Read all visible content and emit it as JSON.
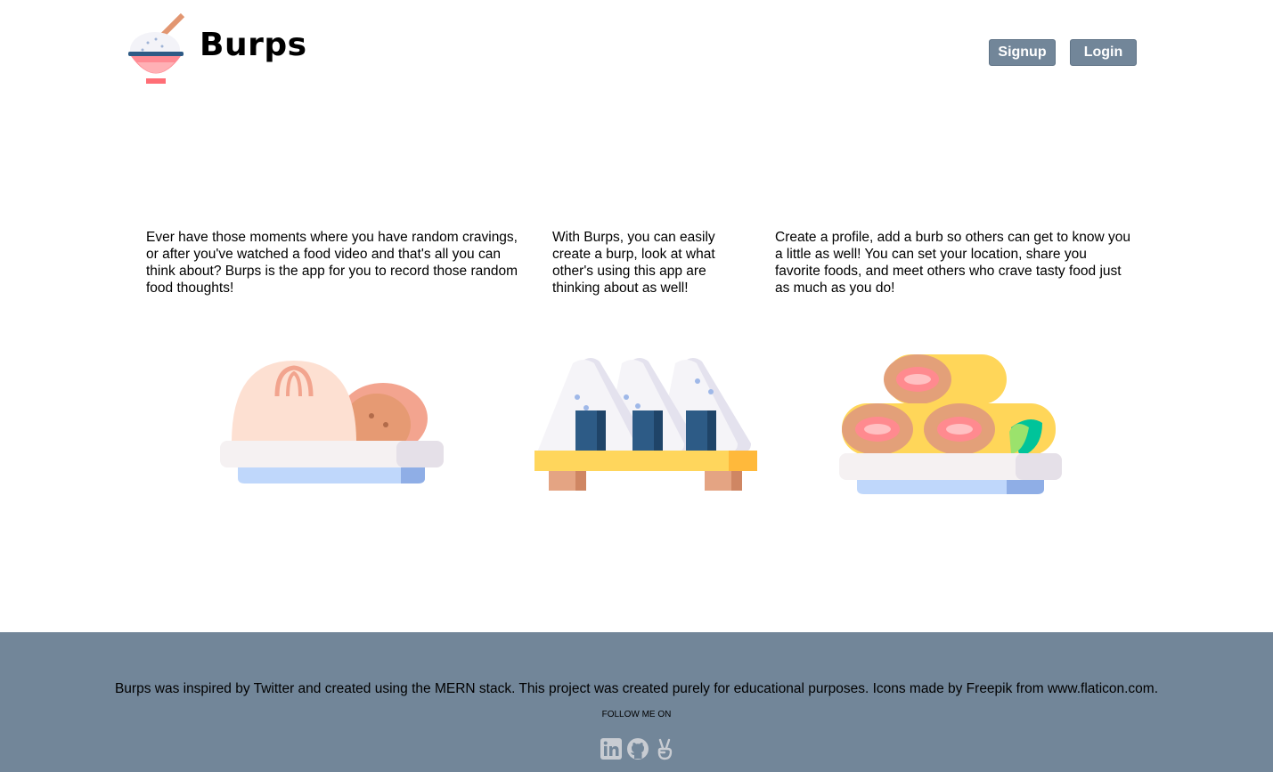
{
  "header": {
    "brand": "Burps",
    "signup_label": "Signup",
    "login_label": "Login"
  },
  "features": [
    {
      "text": "Ever have those moments where you have random cravings, or after you've watched a food video and that's all you can think about? Burps is the app for you to record those random food thoughts!",
      "illustration": "dumpling-plate-icon"
    },
    {
      "text": "With Burps, you can easily create a burp, look at what other's using this app are thinking about as well!",
      "illustration": "onigiri-tray-icon"
    },
    {
      "text": "Create a profile, add a burb so others can get to know you a little as well! You can set your location, share you favorite foods, and meet others who crave tasty food just as much as you do!",
      "illustration": "egg-roll-plate-icon"
    }
  ],
  "footer": {
    "text": "Burps was inspired by Twitter and created using the MERN stack. This project was created purely for educational purposes. Icons made by Freepik from www.flaticon.com.",
    "follow_label": "FOLLOW ME ON",
    "socials": [
      "linkedin-icon",
      "github-icon",
      "angellist-icon"
    ]
  },
  "colors": {
    "button": "#728699",
    "footer_bg": "#728699"
  }
}
